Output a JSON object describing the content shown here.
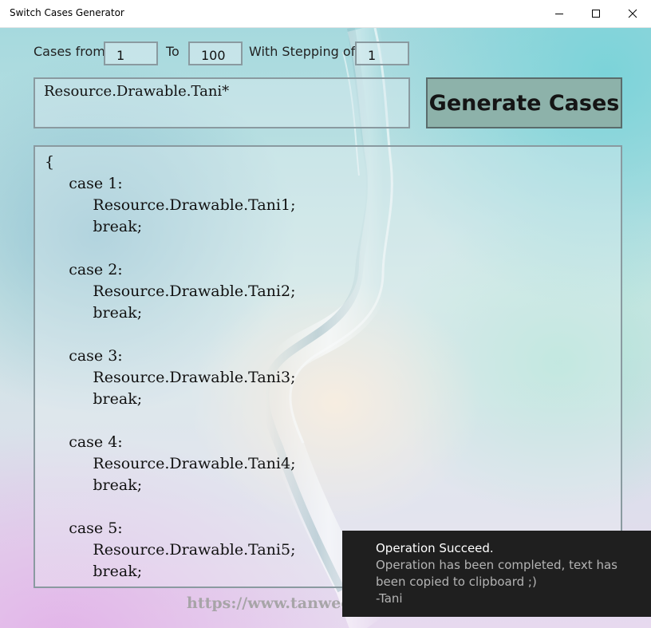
{
  "window": {
    "title": "Switch Cases Generator"
  },
  "controls": {
    "from_label": "Cases from",
    "from_value": "1",
    "to_label": "To",
    "to_value": "100",
    "step_label": "With Stepping of",
    "step_value": "1",
    "prefix_value": "Resource.Drawable.Tani*",
    "generate_label": "Generate Cases"
  },
  "output": {
    "text": "{\n     case 1:\n          Resource.Drawable.Tani1;\n          break;\n\n     case 2:\n          Resource.Drawable.Tani2;\n          break;\n\n     case 3:\n          Resource.Drawable.Tani3;\n          break;\n\n     case 4:\n          Resource.Drawable.Tani4;\n          break;\n\n     case 5:\n          Resource.Drawable.Tani5;\n          break;"
  },
  "footer": {
    "link_text": "https://www.tanweer"
  },
  "toast": {
    "title": "Operation Succeed.",
    "message": "Operation has been completed, text has been copied to clipboard ;)",
    "signature": "-Tani"
  },
  "icons": {
    "minimize": "minimize-icon",
    "maximize": "maximize-icon",
    "close": "close-icon"
  }
}
